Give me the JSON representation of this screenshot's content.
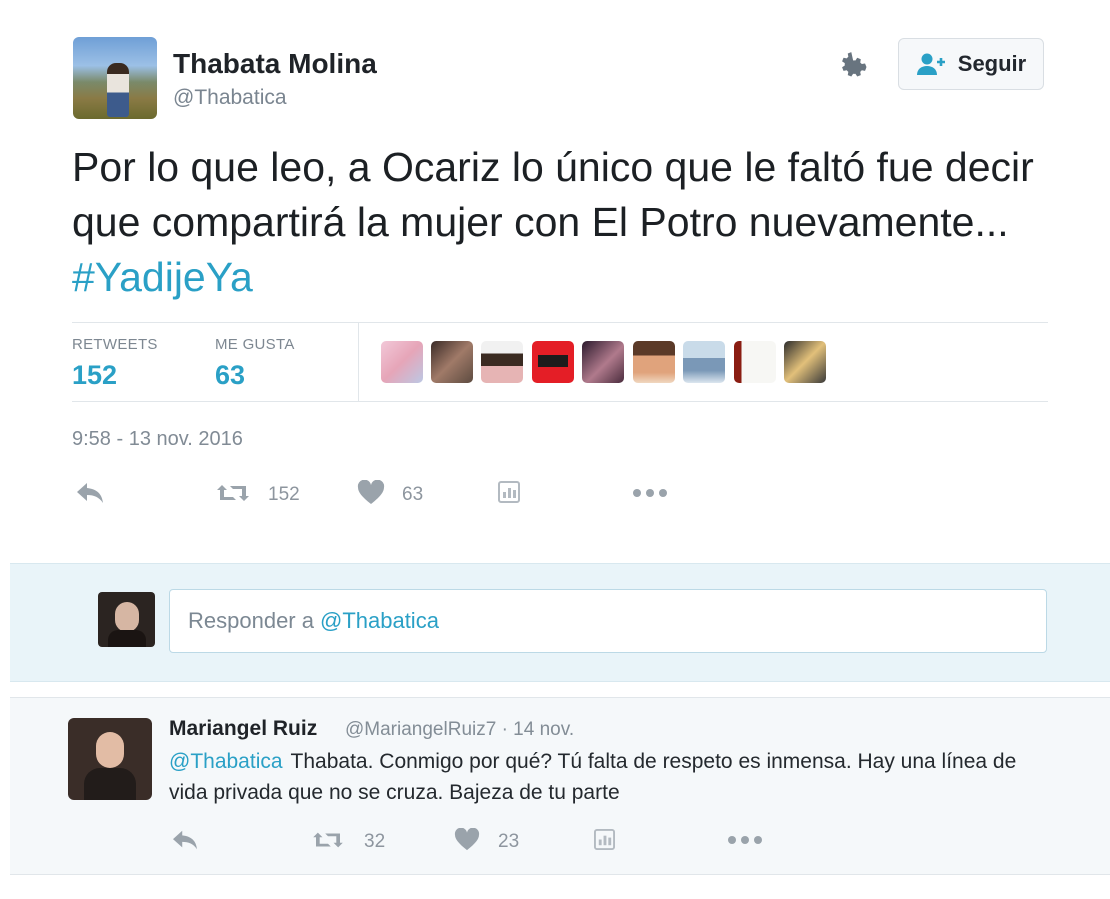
{
  "author": {
    "name": "Thabata Molina",
    "handle": "@Thabatica"
  },
  "header": {
    "follow_label": "Seguir"
  },
  "tweet": {
    "text": "Por lo que leo, a Ocariz lo único que le faltó fue decir que compartirá la mujer con El Potro nuevamente...",
    "hashtag": "#YadijeYa",
    "timestamp": "9:58 - 13 nov. 2016"
  },
  "stats": {
    "retweets_label": "RETWEETS",
    "retweets_value": "152",
    "likes_label": "ME GUSTA",
    "likes_value": "63"
  },
  "actions": {
    "retweet_count": "152",
    "like_count": "63"
  },
  "reply_composer": {
    "placeholder_prefix": "Responder a",
    "mention": "@Thabatica"
  },
  "reply": {
    "name": "Mariangel Ruiz",
    "meta": "@MariangelRuiz7 · 14 nov.",
    "mention": "@Thabatica",
    "text": "Thabata. Conmigo por qué? Tú falta de respeto es inmensa. Hay una línea de vida privada que no se cruza. Bajeza de tu parte",
    "retweet_count": "32",
    "like_count": "23"
  },
  "colors": {
    "link": "#2aa0c6",
    "muted": "#8d959e",
    "reply_bg": "#e9f4f9"
  },
  "icons": [
    "gear-icon",
    "follow-person-icon",
    "reply-icon",
    "retweet-icon",
    "heart-icon",
    "analytics-icon",
    "more-icon"
  ]
}
